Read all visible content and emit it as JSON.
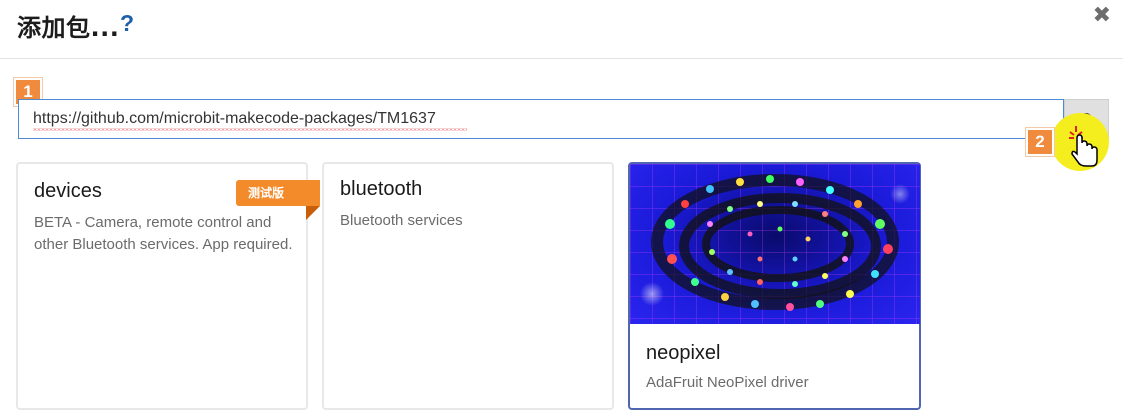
{
  "dialog": {
    "title": "添加包...",
    "help_icon": "?",
    "close_icon": "✖"
  },
  "steps": [
    "1",
    "2"
  ],
  "search": {
    "value": "https://github.com/microbit-makecode-packages/TM1637",
    "button_icon": "search-icon"
  },
  "packages": [
    {
      "name": "devices",
      "description": "BETA - Camera, remote control and other Bluetooth services. App required.",
      "badge": "测试版"
    },
    {
      "name": "bluetooth",
      "description": "Bluetooth services"
    },
    {
      "name": "neopixel",
      "description": "AdaFruit NeoPixel driver",
      "selected": true
    }
  ],
  "colors": {
    "accent": "#4f8ad6",
    "step_badge": "#f08a3c",
    "beta_badge": "#f48b2b",
    "selected_border": "#5166b0"
  }
}
